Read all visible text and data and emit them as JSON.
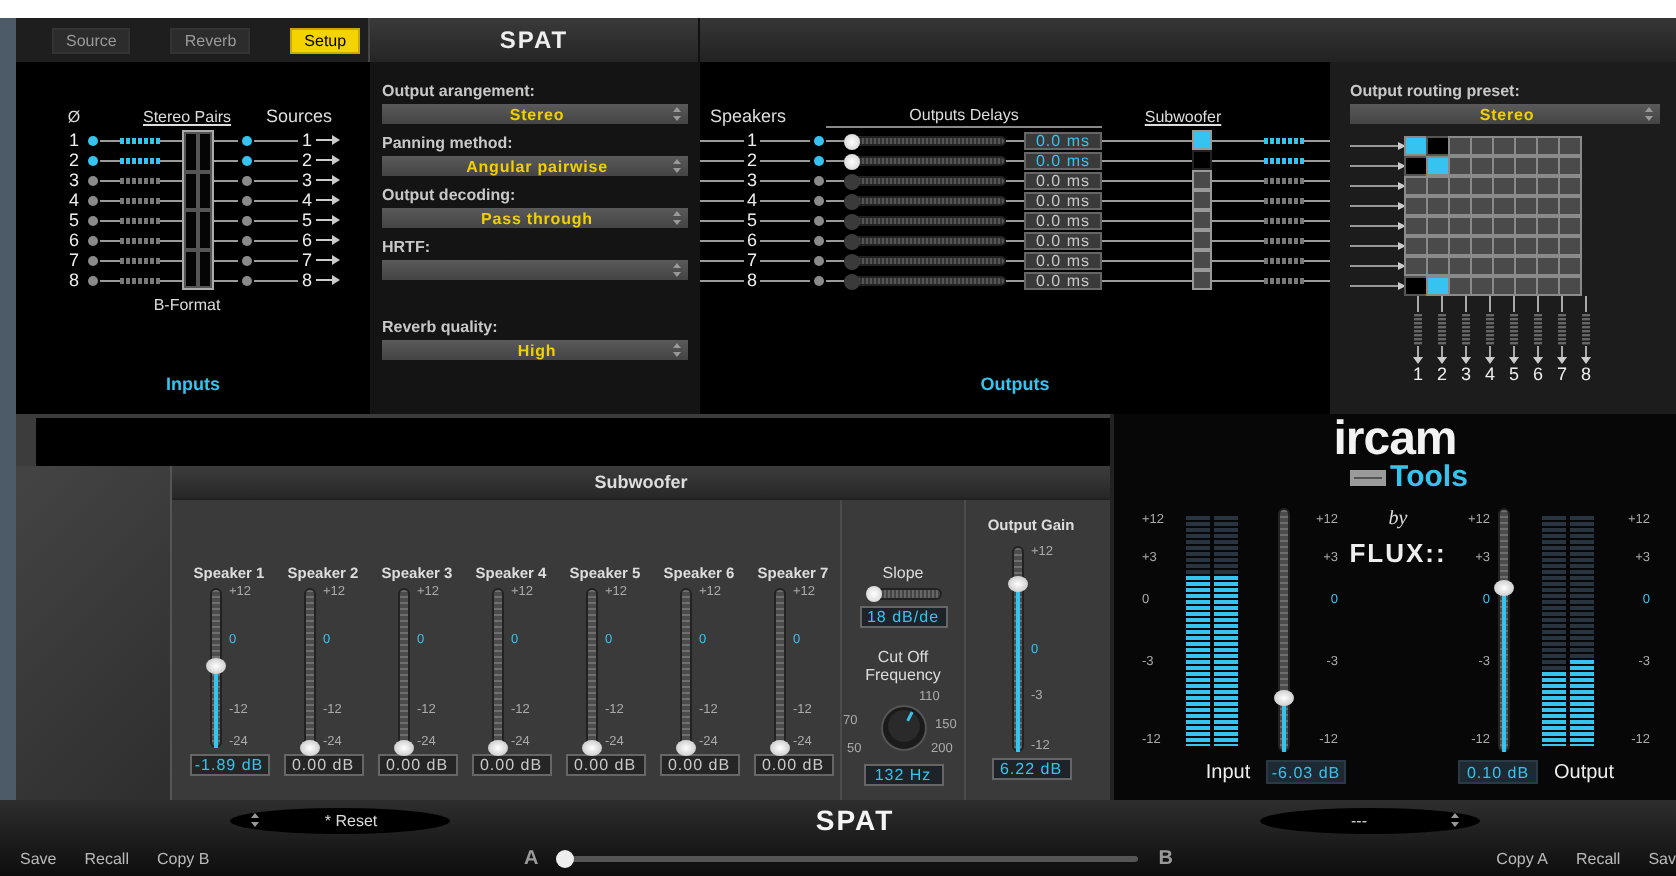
{
  "tabs": [
    {
      "label": "Source",
      "selected": false
    },
    {
      "label": "Reverb",
      "selected": false
    },
    {
      "label": "Setup",
      "selected": true
    }
  ],
  "title": "SPAT",
  "inputs": {
    "phase_label": "Ø",
    "pairs_label": "Stereo Pairs",
    "sources_label": "Sources",
    "format_label": "B-Format",
    "footer": "Inputs",
    "rows": [
      {
        "number": "1",
        "active": true,
        "source": "1"
      },
      {
        "number": "2",
        "active": true,
        "source": "2"
      },
      {
        "number": "3",
        "active": false,
        "source": "3"
      },
      {
        "number": "4",
        "active": false,
        "source": "4"
      },
      {
        "number": "5",
        "active": false,
        "source": "5"
      },
      {
        "number": "6",
        "active": false,
        "source": "6"
      },
      {
        "number": "7",
        "active": false,
        "source": "7"
      },
      {
        "number": "8",
        "active": false,
        "source": "8"
      }
    ]
  },
  "settings": [
    {
      "label": "Output arangement:",
      "value": "Stereo"
    },
    {
      "label": "Panning method:",
      "value": "Angular pairwise"
    },
    {
      "label": "Output decoding:",
      "value": "Pass through"
    },
    {
      "label": "HRTF:"
    },
    {
      "label": "Reverb quality:",
      "value": "High"
    }
  ],
  "outputs": {
    "speakers_label": "Speakers",
    "delays_label": "Outputs Delays",
    "subwoofer_label": "Subwoofer",
    "footer": "Outputs",
    "rows": [
      {
        "number": "1",
        "active": true,
        "level": 0,
        "delay": "0.0 ms",
        "subwoofer_on": true,
        "subwoofer_blocked": false
      },
      {
        "number": "2",
        "active": true,
        "level": 0,
        "delay": "0.0 ms",
        "subwoofer_on": false,
        "subwoofer_blocked": true
      },
      {
        "number": "3",
        "active": false,
        "level": 0,
        "delay": "0.0 ms",
        "subwoofer_on": false,
        "subwoofer_blocked": false
      },
      {
        "number": "4",
        "active": false,
        "level": 0,
        "delay": "0.0 ms",
        "subwoofer_on": false,
        "subwoofer_blocked": false
      },
      {
        "number": "5",
        "active": false,
        "level": 0,
        "delay": "0.0 ms",
        "subwoofer_on": false,
        "subwoofer_blocked": false
      },
      {
        "number": "6",
        "active": false,
        "level": 0,
        "delay": "0.0 ms",
        "subwoofer_on": false,
        "subwoofer_blocked": false
      },
      {
        "number": "7",
        "active": false,
        "level": 0,
        "delay": "0.0 ms",
        "subwoofer_on": false,
        "subwoofer_blocked": false
      },
      {
        "number": "8",
        "active": false,
        "level": 0,
        "delay": "0.0 ms",
        "subwoofer_on": false,
        "subwoofer_blocked": false
      }
    ]
  },
  "routing": {
    "label": "Output routing preset:",
    "value": "Stereo",
    "rows": [
      {
        "cells": [
          {
            "on": true,
            "blocked": false
          },
          {
            "on": false,
            "blocked": true
          },
          {
            "on": false,
            "blocked": false
          },
          {
            "on": false,
            "blocked": false
          },
          {
            "on": false,
            "blocked": false
          },
          {
            "on": false,
            "blocked": false
          },
          {
            "on": false,
            "blocked": false
          },
          {
            "on": false,
            "blocked": false
          }
        ]
      },
      {
        "cells": [
          {
            "on": false,
            "blocked": true
          },
          {
            "on": true,
            "blocked": false
          },
          {
            "on": false,
            "blocked": false
          },
          {
            "on": false,
            "blocked": false
          },
          {
            "on": false,
            "blocked": false
          },
          {
            "on": false,
            "blocked": false
          },
          {
            "on": false,
            "blocked": false
          },
          {
            "on": false,
            "blocked": false
          }
        ]
      },
      {
        "cells": [
          {
            "on": false,
            "blocked": false
          },
          {
            "on": false,
            "blocked": false
          },
          {
            "on": false,
            "blocked": false
          },
          {
            "on": false,
            "blocked": false
          },
          {
            "on": false,
            "blocked": false
          },
          {
            "on": false,
            "blocked": false
          },
          {
            "on": false,
            "blocked": false
          },
          {
            "on": false,
            "blocked": false
          }
        ]
      },
      {
        "cells": [
          {
            "on": false,
            "blocked": false
          },
          {
            "on": false,
            "blocked": false
          },
          {
            "on": false,
            "blocked": false
          },
          {
            "on": false,
            "blocked": false
          },
          {
            "on": false,
            "blocked": false
          },
          {
            "on": false,
            "blocked": false
          },
          {
            "on": false,
            "blocked": false
          },
          {
            "on": false,
            "blocked": false
          }
        ]
      },
      {
        "cells": [
          {
            "on": false,
            "blocked": false
          },
          {
            "on": false,
            "blocked": false
          },
          {
            "on": false,
            "blocked": false
          },
          {
            "on": false,
            "blocked": false
          },
          {
            "on": false,
            "blocked": false
          },
          {
            "on": false,
            "blocked": false
          },
          {
            "on": false,
            "blocked": false
          },
          {
            "on": false,
            "blocked": false
          }
        ]
      },
      {
        "cells": [
          {
            "on": false,
            "blocked": false
          },
          {
            "on": false,
            "blocked": false
          },
          {
            "on": false,
            "blocked": false
          },
          {
            "on": false,
            "blocked": false
          },
          {
            "on": false,
            "blocked": false
          },
          {
            "on": false,
            "blocked": false
          },
          {
            "on": false,
            "blocked": false
          },
          {
            "on": false,
            "blocked": false
          }
        ]
      },
      {
        "cells": [
          {
            "on": false,
            "blocked": false
          },
          {
            "on": false,
            "blocked": false
          },
          {
            "on": false,
            "blocked": false
          },
          {
            "on": false,
            "blocked": false
          },
          {
            "on": false,
            "blocked": false
          },
          {
            "on": false,
            "blocked": false
          },
          {
            "on": false,
            "blocked": false
          },
          {
            "on": false,
            "blocked": false
          }
        ]
      },
      {
        "cells": [
          {
            "on": false,
            "blocked": true
          },
          {
            "on": true,
            "blocked": false
          },
          {
            "on": false,
            "blocked": false
          },
          {
            "on": false,
            "blocked": false
          },
          {
            "on": false,
            "blocked": false
          },
          {
            "on": false,
            "blocked": false
          },
          {
            "on": false,
            "blocked": false
          },
          {
            "on": false,
            "blocked": false
          }
        ]
      }
    ],
    "outputs": [
      "1",
      "2",
      "3",
      "4",
      "5",
      "6",
      "7",
      "8"
    ]
  },
  "subwoofer": {
    "title": "Subwoofer",
    "speakers": [
      {
        "name": "Speaker 1",
        "active": true,
        "level": 0.51,
        "reading": "-1.89 dB",
        "scale": [
          "+12",
          "0",
          "-12",
          "-24"
        ]
      },
      {
        "name": "Speaker 2",
        "active": false,
        "level": 0,
        "reading": "0.00 dB",
        "scale": [
          "+12",
          "0",
          "-12",
          "-24"
        ]
      },
      {
        "name": "Speaker 3",
        "active": false,
        "level": 0,
        "reading": "0.00 dB",
        "scale": [
          "+12",
          "0",
          "-12",
          "-24"
        ]
      },
      {
        "name": "Speaker 4",
        "active": false,
        "level": 0,
        "reading": "0.00 dB",
        "scale": [
          "+12",
          "0",
          "-12",
          "-24"
        ]
      },
      {
        "name": "Speaker 5",
        "active": false,
        "level": 0,
        "reading": "0.00 dB",
        "scale": [
          "+12",
          "0",
          "-12",
          "-24"
        ]
      },
      {
        "name": "Speaker 6",
        "active": false,
        "level": 0,
        "reading": "0.00 dB",
        "scale": [
          "+12",
          "0",
          "-12",
          "-24"
        ]
      },
      {
        "name": "Speaker 7",
        "active": false,
        "level": 0,
        "reading": "0.00 dB",
        "scale": [
          "+12",
          "0",
          "-12",
          "-24"
        ]
      }
    ],
    "slope": {
      "label": "Slope",
      "level": 0,
      "reading": "18 dB/de"
    },
    "cutoff": {
      "label": "Cut Off Frequency",
      "level": 0.6,
      "ticks": [
        "50",
        "70",
        "110",
        "150",
        "200"
      ],
      "reading": "132 Hz"
    },
    "output_gain": {
      "label": "Output Gain",
      "level": 0.82,
      "reading": "6.22 dB",
      "scale": [
        "+12",
        "0",
        "-3",
        "-12"
      ]
    }
  },
  "logo": {
    "name": "ircam",
    "suffix": "Tools",
    "by": "by",
    "maker": "FLUX::"
  },
  "meters": [
    {
      "kind": "input",
      "label": "Input",
      "reading": "-6.03 dB",
      "level": 0.22,
      "meter_scale": [
        "+12",
        "+3",
        "0",
        "-3",
        "-12"
      ],
      "fader_scale": [
        "+12",
        "+3",
        "0",
        "-3",
        "-12"
      ],
      "meters": [
        {
          "level": 0.74
        },
        {
          "level": 0.74
        }
      ]
    },
    {
      "kind": "output",
      "label": "Output",
      "reading": "0.10 dB",
      "level": 0.67,
      "meter_scale": [
        "+12",
        "+3",
        "0",
        "-3",
        "-12"
      ],
      "fader_scale": [
        "+12",
        "+3",
        "0",
        "-3",
        "-12"
      ],
      "meters": [
        {
          "level": 0.33
        },
        {
          "level": 0.37
        }
      ]
    }
  ],
  "footer": {
    "left_buttons": [
      "Save",
      "Recall",
      "Copy B"
    ],
    "left_preset": "* Reset",
    "title": "SPAT",
    "morph": {
      "a": "A",
      "b": "B",
      "level": 0
    },
    "right_preset": "---",
    "right_buttons": [
      "Copy A",
      "Recall",
      "Sav"
    ]
  }
}
